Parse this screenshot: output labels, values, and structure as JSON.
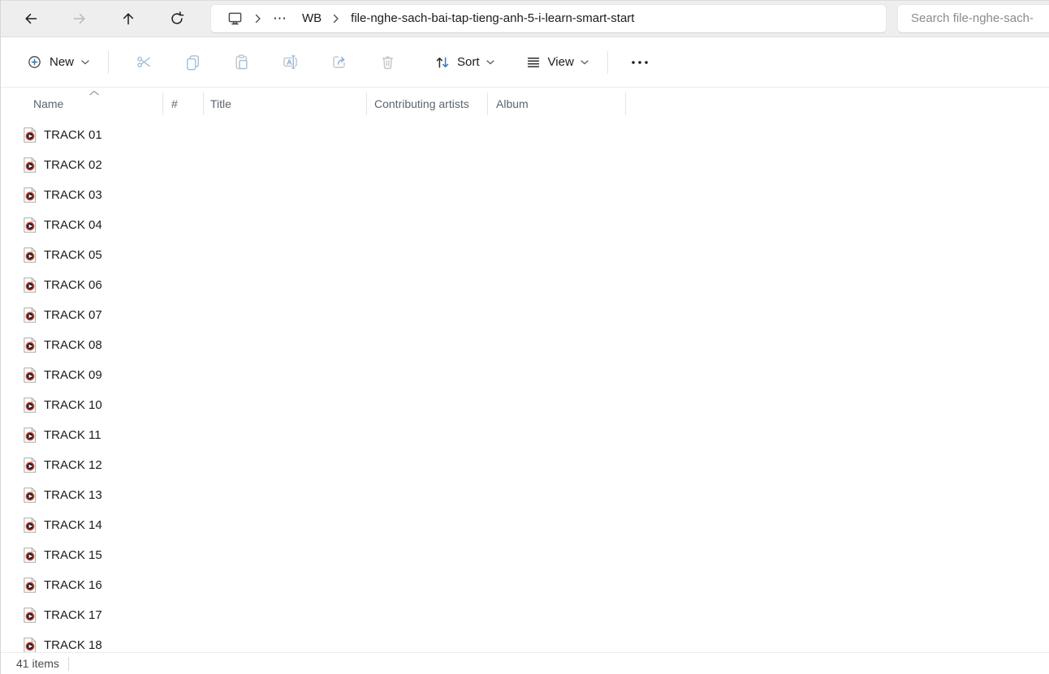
{
  "navbar": {
    "breadcrumb": {
      "ellipsis": "⋯",
      "parent": "WB",
      "current": "file-nghe-sach-bai-tap-tieng-anh-5-i-learn-smart-start"
    },
    "search": {
      "placeholder": "Search file-nghe-sach-"
    }
  },
  "toolbar": {
    "new_label": "New",
    "sort_label": "Sort",
    "view_label": "View"
  },
  "columns": [
    {
      "label": "Name",
      "sorted": "ascending"
    },
    {
      "label": "#"
    },
    {
      "label": "Title"
    },
    {
      "label": "Contributing artists"
    },
    {
      "label": "Album"
    }
  ],
  "files": [
    "TRACK 01",
    "TRACK 02",
    "TRACK 03",
    "TRACK 04",
    "TRACK 05",
    "TRACK 06",
    "TRACK 07",
    "TRACK 08",
    "TRACK 09",
    "TRACK 10",
    "TRACK 11",
    "TRACK 12",
    "TRACK 13",
    "TRACK 14",
    "TRACK 15",
    "TRACK 16",
    "TRACK 17",
    "TRACK 18"
  ],
  "status": {
    "items_count": "41 items"
  },
  "icons": {
    "back-icon": "arrow-left",
    "forward-icon": "arrow-right (disabled)",
    "up-icon": "arrow-up",
    "refresh-icon": "circular-arrow",
    "this-pc-icon": "monitor",
    "breadcrumb-chevron-icon": "›",
    "new-icon": "plus-in-circle",
    "chevron-down-icon": "˅",
    "cut-icon": "scissors",
    "copy-icon": "overlapping-pages",
    "paste-icon": "clipboard",
    "rename-icon": "letter-a-with-text-cursor",
    "share-icon": "arrow-out-of-box",
    "delete-icon": "trash-can",
    "sort-icon": "up-down-arrows",
    "view-icon": "horizontal-lines",
    "more-options-icon": "three-dots",
    "audio-file-icon": "page-with-play-disc",
    "sort-ascending-icon": "chevron-up"
  },
  "colors": {
    "navbar_bg": "#eeeeef",
    "accent_blue": "#3b77bd",
    "muted_blue_icon": "#a4c1dc",
    "muted_gray_icon": "#c7c7c7",
    "disc_ring": "#cf4a1d",
    "disc_fill": "#241b38",
    "header_text": "#5b6470"
  }
}
